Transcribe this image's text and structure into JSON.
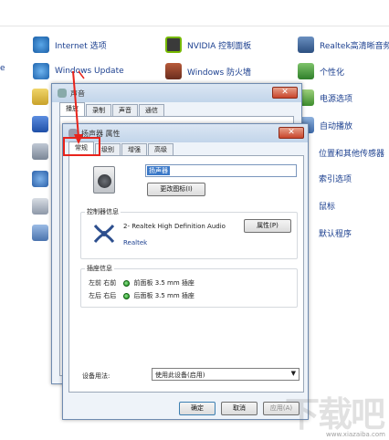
{
  "control_panel": {
    "left_edge_char": "e",
    "items_col1": [
      "Internet 选项",
      "Windows Update"
    ],
    "items_col2": [
      "NVIDIA 控制面板",
      "Windows 防火墙"
    ],
    "items_col3": [
      "Realtek高清晰音频",
      "个性化",
      "电源选项",
      "自动播放",
      "位置和其他传感器",
      "索引选项",
      "鼠标",
      "默认程序"
    ]
  },
  "sound_dialog": {
    "title": "声音",
    "tabs": [
      "播放",
      "录制",
      "声音",
      "通信"
    ]
  },
  "speaker_props": {
    "title": "扬声器 属性",
    "tabs": [
      "常规",
      "级别",
      "增强",
      "高级"
    ],
    "device_name": "扬声器",
    "change_icon_label": "更改图标(I)",
    "controller_group_label": "控制器信息",
    "controller_name": "2- Realtek High Definition Audio",
    "controller_vendor": "Realtek",
    "properties_button": "属性(P)",
    "jack_group_label": "插座信息",
    "jacks": [
      {
        "channels": "左前 右前",
        "description": "前面板 3.5 mm 插座"
      },
      {
        "channels": "左后 右后",
        "description": "后面板 3.5 mm 插座"
      }
    ],
    "device_usage_label": "设备用法:",
    "device_usage_value": "使用此设备(启用)",
    "ok_label": "确定",
    "cancel_label": "取消",
    "apply_label": "应用(A)"
  },
  "watermark": {
    "big": "下载吧",
    "small": "www.xiazaiba.com"
  },
  "colors": {
    "annotation": "#e8231b",
    "link": "#1b3f8f"
  }
}
